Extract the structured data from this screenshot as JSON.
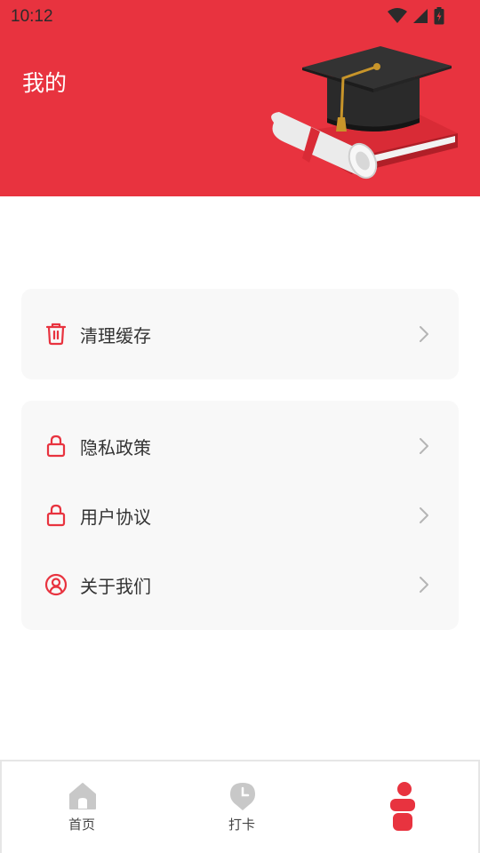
{
  "status_bar": {
    "time": "10:12"
  },
  "header": {
    "title": "我的"
  },
  "menu": {
    "cache": {
      "label": "清理缓存",
      "icon": "trash-icon"
    },
    "items": [
      {
        "label": "隐私政策",
        "icon": "lock-icon"
      },
      {
        "label": "用户协议",
        "icon": "lock-icon"
      },
      {
        "label": "关于我们",
        "icon": "user-circle-icon"
      }
    ]
  },
  "bottom_nav": {
    "items": [
      {
        "label": "首页",
        "icon": "home-icon",
        "active": false
      },
      {
        "label": "打卡",
        "icon": "clock-pin-icon",
        "active": false
      },
      {
        "label": "",
        "icon": "person-icon",
        "active": true
      }
    ]
  },
  "colors": {
    "accent": "#e8333f",
    "card_bg": "#f8f8f8",
    "inactive_icon": "#c8c8c8"
  }
}
